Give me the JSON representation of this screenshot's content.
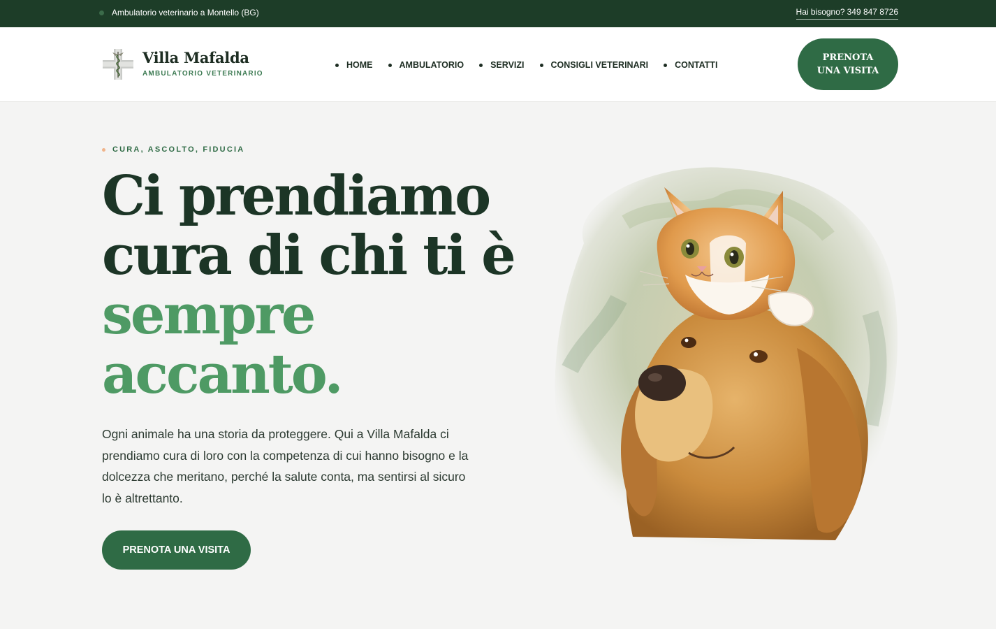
{
  "topbar": {
    "location": "Ambulatorio veterinario a Montello (BG)",
    "help_label": "Hai bisogno?",
    "phone": "349 847 8726"
  },
  "brand": {
    "name": "Villa Mafalda",
    "tagline": "AMBULATORIO VETERINARIO",
    "logo_icon": "caduceus-cross-icon"
  },
  "nav": {
    "items": [
      {
        "label": "HOME"
      },
      {
        "label": "AMBULATORIO"
      },
      {
        "label": "SERVIZI"
      },
      {
        "label": "CONSIGLI VETERINARI"
      },
      {
        "label": "CONTATTI"
      }
    ]
  },
  "header": {
    "cta_line1": "PRENOTA",
    "cta_line2": "UNA VISITA"
  },
  "hero": {
    "eyebrow": "CURA, ASCOLTO, FIDUCIA",
    "headline_line1": "Ci prendiamo",
    "headline_line2": "cura di chi ti è",
    "headline_line3": "sempre",
    "headline_line4": "accanto.",
    "lead": "Ogni animale ha una storia da proteggere. Qui a Villa Mafalda ci prendiamo cura di loro con la competenza di cui hanno bisogno e la dolcezza che meritano, perché la salute conta, ma sentirsi al sicuro lo è altrettanto.",
    "cta": "PRENOTA UNA VISITA",
    "image": "watercolor-cat-on-dog-illustration"
  },
  "colors": {
    "topbar_bg": "#1d3d28",
    "accent": "#2f6b45",
    "headline_dark": "#1c3526",
    "headline_green": "#4e9a64",
    "eyebrow_dot": "#f0b48a",
    "page_bg": "#f4f4f3"
  }
}
